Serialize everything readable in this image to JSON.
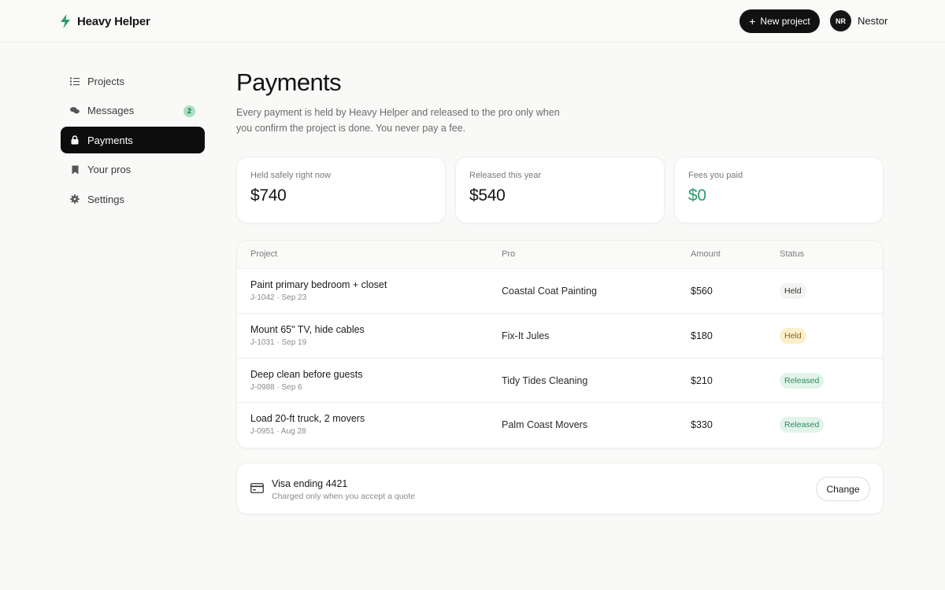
{
  "brand": {
    "name": "Heavy Helper",
    "accent": "#2d9b6c"
  },
  "header": {
    "new_project_label": "New project",
    "user": {
      "initials": "NR",
      "name": "Nestor"
    }
  },
  "sidebar": {
    "items": [
      {
        "label": "Projects",
        "icon": "list-icon"
      },
      {
        "label": "Messages",
        "icon": "chat-icon",
        "badge": "2"
      },
      {
        "label": "Payments",
        "icon": "lock-icon",
        "active": true
      },
      {
        "label": "Your pros",
        "icon": "bookmark-icon"
      },
      {
        "label": "Settings",
        "icon": "gear-icon"
      }
    ]
  },
  "main": {
    "title": "Payments",
    "subtitle": "Every payment is held by Heavy Helper and released to the pro only when you confirm the project is done. You never pay a fee.",
    "stats": [
      {
        "label": "Held safely right now",
        "value": "$740"
      },
      {
        "label": "Released this year",
        "value": "$540"
      },
      {
        "label": "Fees you paid",
        "value": "$0"
      }
    ],
    "table": {
      "columns": [
        "Project",
        "Pro",
        "Amount",
        "Status"
      ],
      "rows": [
        {
          "project": "Paint primary bedroom + closet",
          "meta": "J-1042 · Sep 23",
          "pro": "Coastal Coat Painting",
          "amount": "$560",
          "status": "Held"
        },
        {
          "project": "Mount 65\" TV, hide cables",
          "meta": "J-1031 · Sep 19",
          "pro": "Fix-It Jules",
          "amount": "$180",
          "status": "Held"
        },
        {
          "project": "Deep clean before guests",
          "meta": "J-0988 · Sep 6",
          "pro": "Tidy Tides Cleaning",
          "amount": "$210",
          "status": "Released"
        },
        {
          "project": "Load 20-ft truck, 2 movers",
          "meta": "J-0951 · Aug 28",
          "pro": "Palm Coast Movers",
          "amount": "$330",
          "status": "Released"
        }
      ]
    },
    "payment_method": {
      "name": "Visa ending 4421",
      "note": "Charged only when you accept a quote",
      "change_label": "Change"
    }
  }
}
